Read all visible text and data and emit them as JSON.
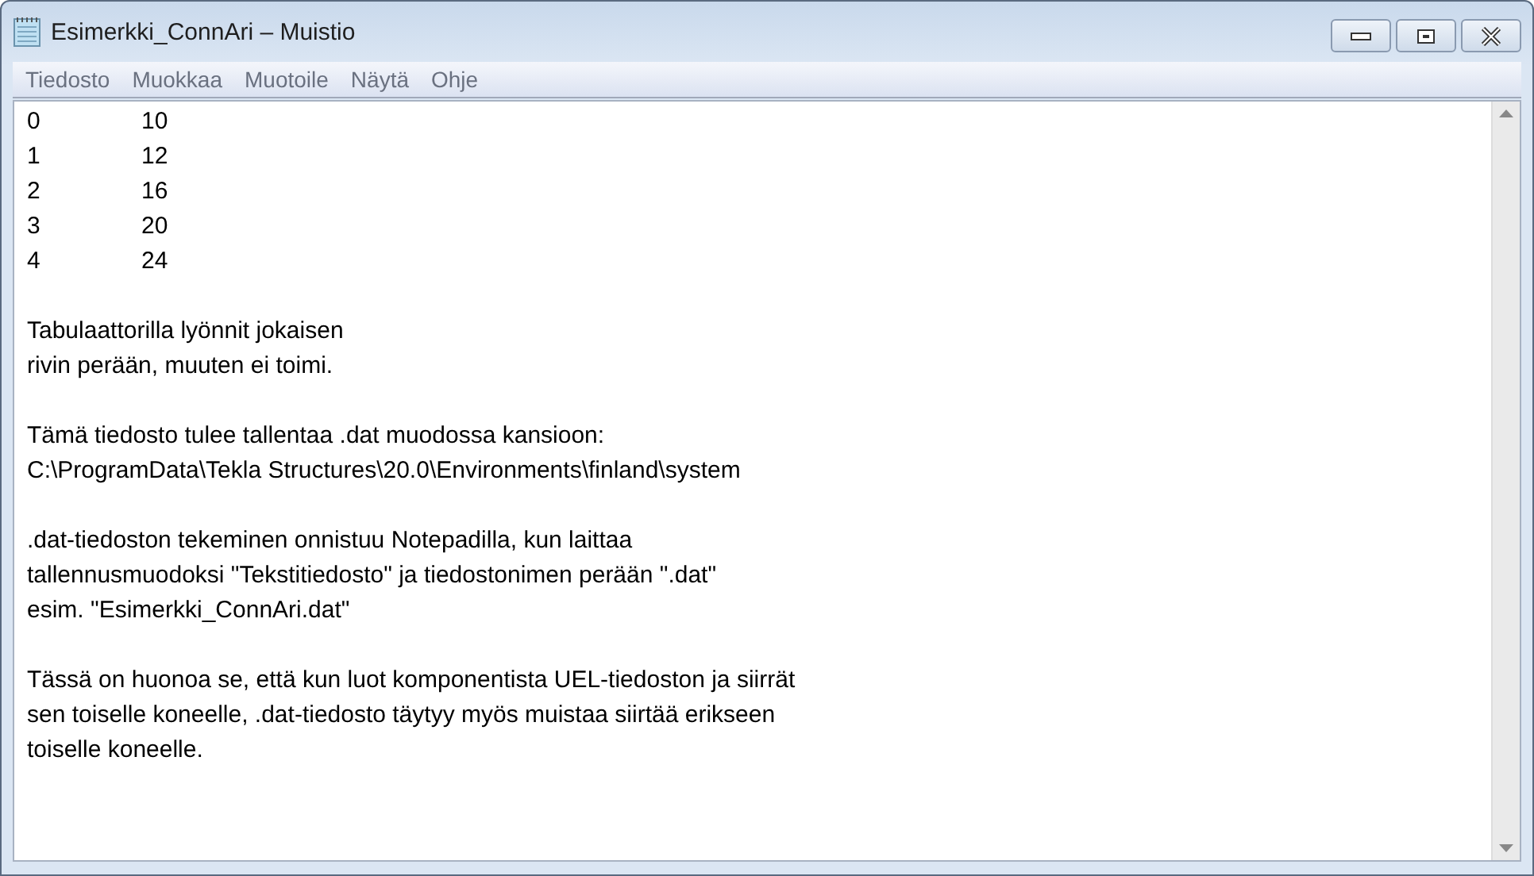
{
  "window": {
    "title": "Esimerkki_ConnAri – Muistio"
  },
  "menu": [
    "Tiedosto",
    "Muokkaa",
    "Muotoile",
    "Näytä",
    "Ohje"
  ],
  "table_rows": [
    {
      "cells": [
        "0",
        "10"
      ]
    },
    {
      "cells": [
        "1",
        "12"
      ]
    },
    {
      "cells": [
        "2",
        "16"
      ]
    },
    {
      "cells": [
        "3",
        "20"
      ]
    },
    {
      "cells": [
        "4",
        "24"
      ]
    }
  ],
  "paragraphs": [
    {
      "lines": [
        "Tabulaattorilla lyönnit jokaisen",
        "rivin perään, muuten ei toimi."
      ]
    },
    {
      "lines": [
        "Tämä tiedosto tulee tallentaa .dat muodossa kansioon:",
        "C:\\ProgramData\\Tekla Structures\\20.0\\Environments\\finland\\system"
      ]
    },
    {
      "lines": [
        ".dat-tiedoston tekeminen onnistuu Notepadilla, kun laittaa",
        "tallennusmuodoksi \"Tekstitiedosto\" ja tiedostonimen perään \".dat\"",
        "esim. \"Esimerkki_ConnAri.dat\""
      ]
    },
    {
      "lines": [
        "Tässä on huonoa se, että kun luot komponentista UEL-tiedoston ja siirrät",
        "sen toiselle koneelle, .dat-tiedosto täytyy myös muistaa siirtää erikseen",
        "toiselle koneelle."
      ]
    }
  ]
}
